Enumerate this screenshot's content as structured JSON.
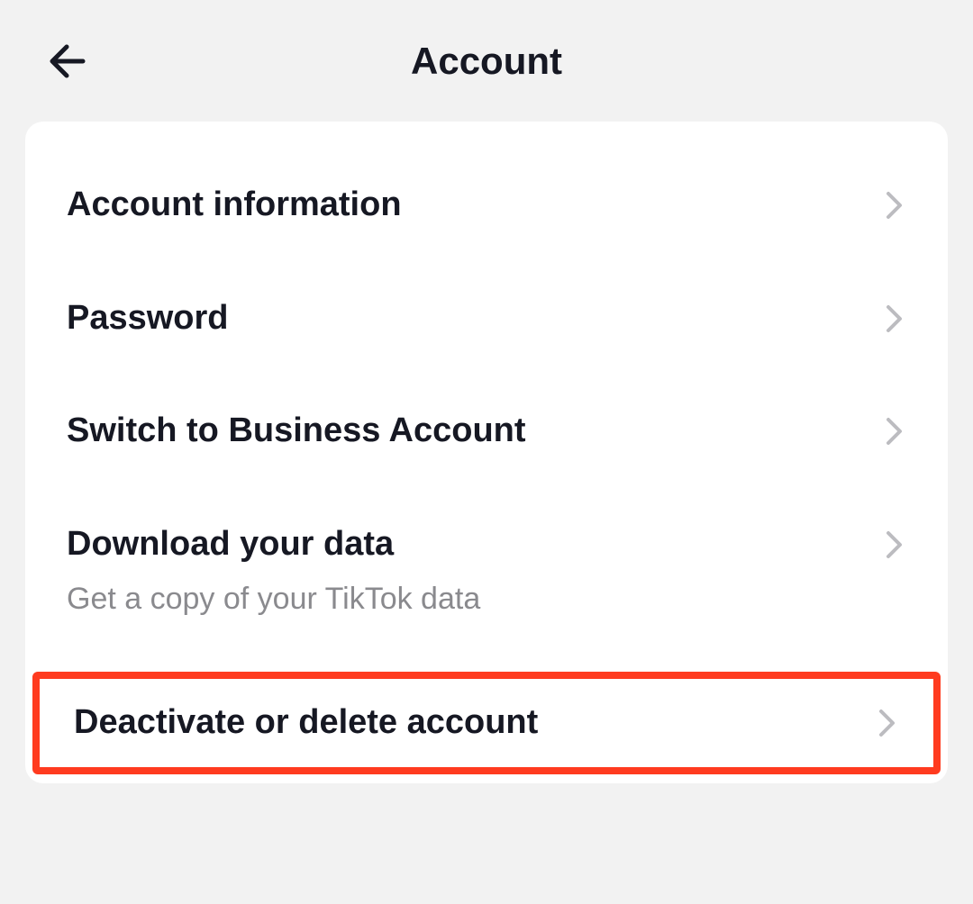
{
  "header": {
    "title": "Account"
  },
  "items": [
    {
      "label": "Account information",
      "subtitle": null
    },
    {
      "label": "Password",
      "subtitle": null
    },
    {
      "label": "Switch to Business Account",
      "subtitle": null
    },
    {
      "label": "Download your data",
      "subtitle": "Get a copy of your TikTok data"
    },
    {
      "label": "Deactivate or delete account",
      "subtitle": null
    }
  ]
}
